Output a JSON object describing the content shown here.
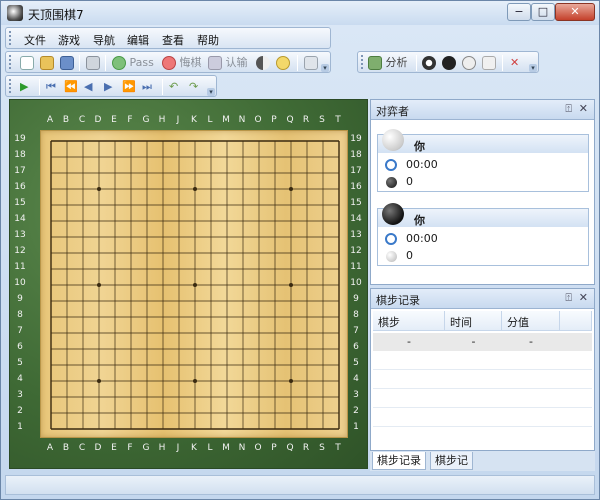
{
  "window": {
    "title": "天顶围棋7",
    "min_glyph": "−",
    "max_glyph": "□",
    "close_glyph": "✕"
  },
  "menu": [
    "文件",
    "游戏",
    "导航",
    "编辑",
    "查看",
    "帮助"
  ],
  "toolbar": {
    "pass_label": "Pass",
    "undo_label": "悔棋",
    "resign_label": "认输",
    "analyze_label": "分析"
  },
  "board": {
    "size": 19,
    "columns": [
      "A",
      "B",
      "C",
      "D",
      "E",
      "F",
      "G",
      "H",
      "J",
      "K",
      "L",
      "M",
      "N",
      "O",
      "P",
      "Q",
      "R",
      "S",
      "T"
    ],
    "rows": [
      "19",
      "18",
      "17",
      "16",
      "15",
      "14",
      "13",
      "12",
      "11",
      "10",
      "9",
      "8",
      "7",
      "6",
      "5",
      "4",
      "3",
      "2",
      "1"
    ]
  },
  "players_panel": {
    "title": "对弈者",
    "pin_glyph": "⍐",
    "close_glyph": "✕",
    "white": {
      "name": "你",
      "time": "00:00",
      "captured": "0"
    },
    "black": {
      "name": "你",
      "time": "00:00",
      "captured": "0"
    }
  },
  "moves_panel": {
    "title": "棋步记录",
    "headers": [
      "棋步",
      "时间",
      "分值"
    ],
    "rows": [
      [
        "-",
        "-",
        "-"
      ]
    ]
  },
  "bottom_tabs": [
    "棋步记录",
    "棋步记"
  ],
  "colors": {
    "board_green": "#3f6a35",
    "wood": "#e8c679",
    "accent_blue": "#c8daef"
  }
}
